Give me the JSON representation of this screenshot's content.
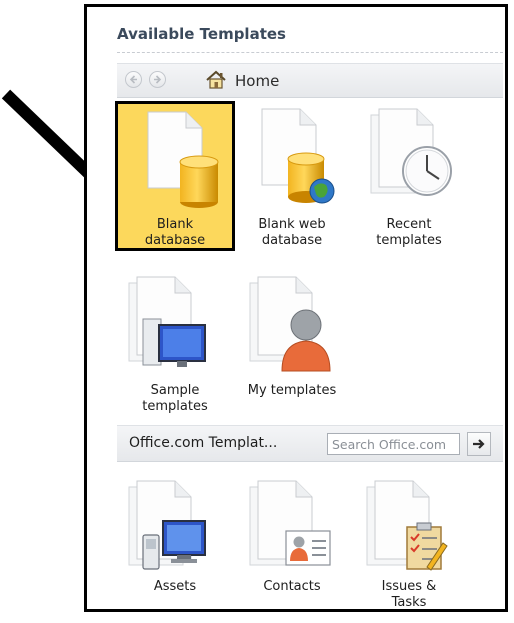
{
  "panel": {
    "title": "Available Templates"
  },
  "nav": {
    "back": "back-arrow-icon",
    "forward": "forward-arrow-icon",
    "home_icon": "home-icon",
    "home_label": "Home"
  },
  "templates": [
    {
      "line1": "Blank",
      "line2": "database",
      "icon": "database-icon",
      "selected": true
    },
    {
      "line1": "Blank web",
      "line2": "database",
      "icon": "web-database-icon"
    },
    {
      "line1": "Recent",
      "line2": "templates",
      "icon": "clock-icon"
    },
    {
      "line1": "Sample",
      "line2": "templates",
      "icon": "computer-icon"
    },
    {
      "line1": "My templates",
      "line2": "",
      "icon": "person-icon"
    }
  ],
  "office": {
    "label": "Office.com Templat...",
    "search_placeholder": "Search Office.com",
    "go_icon": "arrow-right-icon"
  },
  "office_templates": [
    {
      "line1": "Assets",
      "line2": "",
      "icon": "assets-icon"
    },
    {
      "line1": "Contacts",
      "line2": "",
      "icon": "contact-card-icon"
    },
    {
      "line1": "Issues &",
      "line2": "Tasks",
      "icon": "checklist-icon"
    }
  ],
  "colors": {
    "selected_bg": "#fcd85c",
    "title_text": "#3b4a5c"
  }
}
